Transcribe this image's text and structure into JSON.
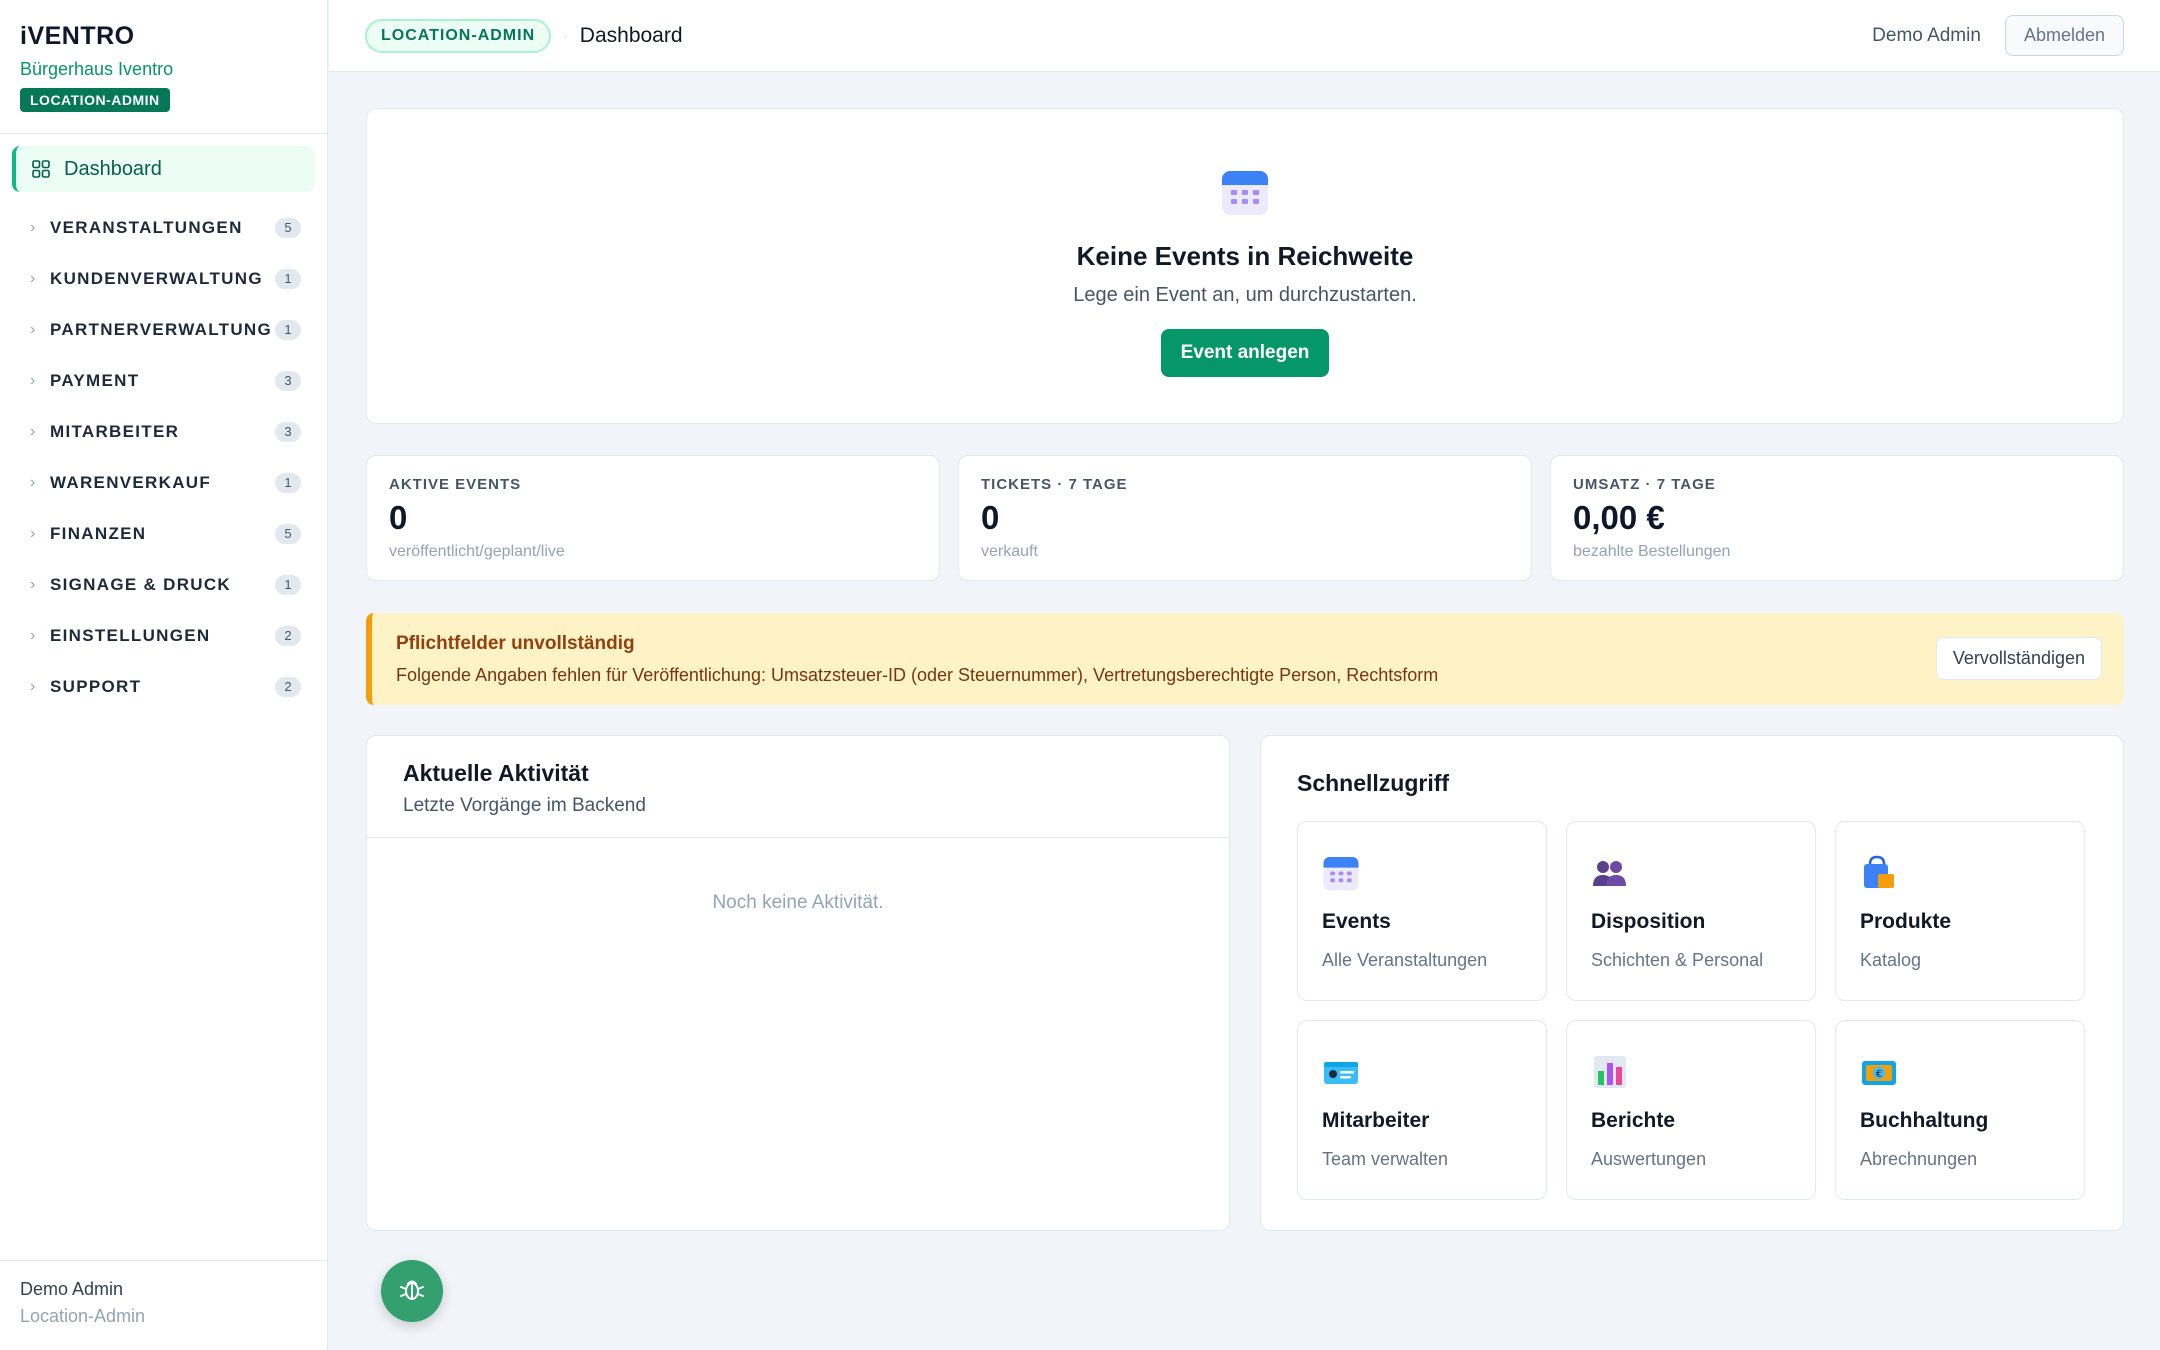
{
  "app": {
    "brand": "iVENTRO",
    "location": "Bürgerhaus Iventro",
    "role_badge": "LOCATION-ADMIN"
  },
  "sidebar": {
    "dashboard_label": "Dashboard",
    "items": [
      {
        "label": "VERANSTALTUNGEN",
        "count": "5"
      },
      {
        "label": "KUNDENVERWALTUNG",
        "count": "1"
      },
      {
        "label": "PARTNERVERWALTUNG",
        "count": "1"
      },
      {
        "label": "PAYMENT",
        "count": "3"
      },
      {
        "label": "MITARBEITER",
        "count": "3"
      },
      {
        "label": "WARENVERKAUF",
        "count": "1"
      },
      {
        "label": "FINANZEN",
        "count": "5"
      },
      {
        "label": "SIGNAGE & DRUCK",
        "count": "1"
      },
      {
        "label": "EINSTELLUNGEN",
        "count": "2"
      },
      {
        "label": "SUPPORT",
        "count": "2"
      }
    ],
    "footer": {
      "name": "Demo Admin",
      "role": "Location-Admin"
    }
  },
  "header": {
    "role_pill": "LOCATION-ADMIN",
    "separator": "·",
    "breadcrumb": "Dashboard",
    "user": "Demo Admin",
    "logout_label": "Abmelden"
  },
  "hero": {
    "title": "Keine Events in Reichweite",
    "subtitle": "Lege ein Event an, um durchzustarten.",
    "cta_label": "Event anlegen"
  },
  "stats": [
    {
      "label": "AKTIVE EVENTS",
      "value": "0",
      "sub": "veröffentlicht/geplant/live"
    },
    {
      "label": "TICKETS · 7 TAGE",
      "value": "0",
      "sub": "verkauft"
    },
    {
      "label": "UMSATZ · 7 TAGE",
      "value": "0,00 €",
      "sub": "bezahlte Bestellungen"
    }
  ],
  "alert": {
    "title": "Pflichtfelder unvollständig",
    "text": "Folgende Angaben fehlen für Veröffentlichung: Umsatzsteuer-ID (oder Steuernummer), Vertretungsberechtigte Person, Rechtsform",
    "button_label": "Vervollständigen"
  },
  "activity": {
    "title": "Aktuelle Aktivität",
    "subtitle": "Letzte Vorgänge im Backend",
    "empty_text": "Noch keine Aktivität."
  },
  "quick": {
    "title": "Schnellzugriff",
    "tiles": [
      {
        "title": "Events",
        "sub": "Alle Veranstaltungen",
        "icon": "calendar-icon"
      },
      {
        "title": "Disposition",
        "sub": "Schichten & Personal",
        "icon": "people-icon"
      },
      {
        "title": "Produkte",
        "sub": "Katalog",
        "icon": "shopping-bag-icon"
      },
      {
        "title": "Mitarbeiter",
        "sub": "Team verwalten",
        "icon": "id-card-icon"
      },
      {
        "title": "Berichte",
        "sub": "Auswertungen",
        "icon": "bar-chart-icon"
      },
      {
        "title": "Buchhaltung",
        "sub": "Abrechnungen",
        "icon": "money-icon"
      }
    ]
  },
  "colors": {
    "accent": "#059669",
    "alert_bg": "#fef3c7",
    "alert_border": "#f59e0b"
  }
}
